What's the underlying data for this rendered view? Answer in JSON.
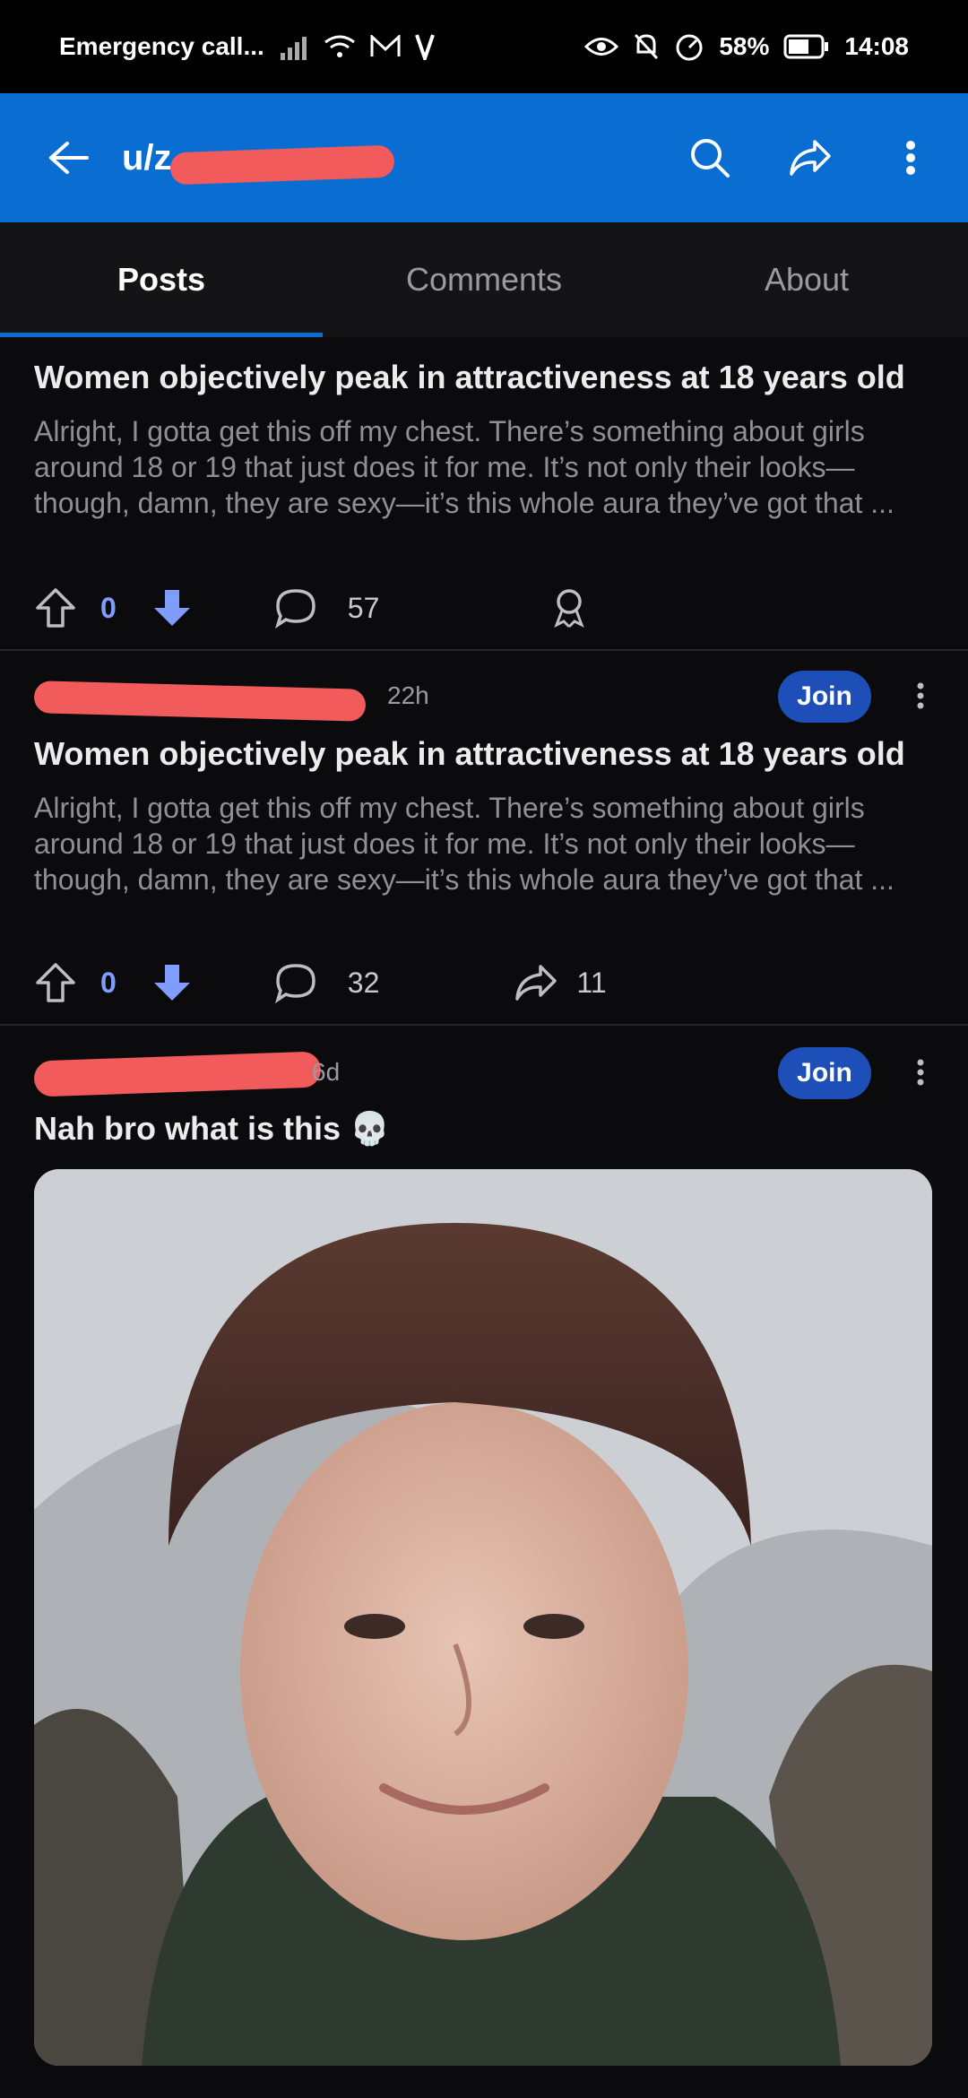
{
  "status": {
    "carrier": "Emergency call...",
    "battery": "58%",
    "time": "14:08"
  },
  "app_bar": {
    "username": "u/z",
    "back_icon": "back-arrow-icon",
    "search_icon": "search-icon",
    "share_icon": "share-icon",
    "more_icon": "more-vertical-icon"
  },
  "tabs": [
    {
      "label": "Posts",
      "active": true
    },
    {
      "label": "Comments",
      "active": false
    },
    {
      "label": "About",
      "active": false
    }
  ],
  "posts": [
    {
      "title": "Women objectively peak in attractiveness at 18 years old",
      "body": "Alright, I gotta get this off my chest. There’s something about girls around 18 or 19 that just does it for me. It’s not only their looks—though, damn, they are sexy—it’s this whole aura they’ve got that ...",
      "votes": "0",
      "comments": "57"
    },
    {
      "time": "22h",
      "join": "Join",
      "title": "Women objectively peak in attractiveness at 18 years old",
      "body": "Alright, I gotta get this off my chest. There’s something about girls around 18 or 19 that just does it for me. It’s not only their looks—though, damn, they are sexy—it’s this whole aura they’ve got that ...",
      "votes": "0",
      "comments": "32",
      "shares": "11"
    },
    {
      "time": "6d",
      "join": "Join",
      "title": "Nah bro what is this 💀"
    }
  ],
  "colors": {
    "accent": "#0a6dd1",
    "join": "#1e4fb8",
    "downvote": "#7f9cff",
    "redaction": "#f25b5b"
  }
}
